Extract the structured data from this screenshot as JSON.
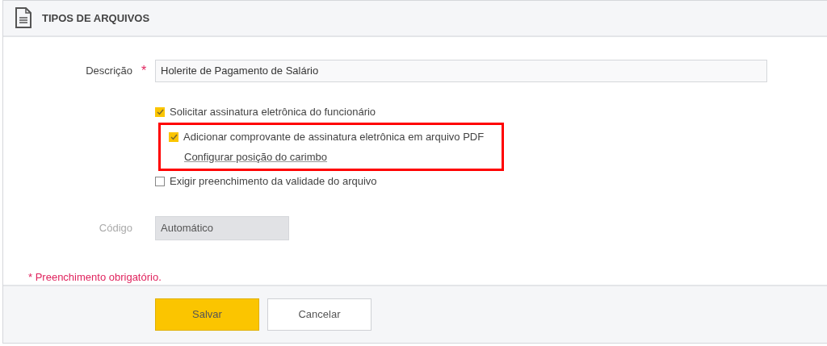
{
  "header": {
    "title": "TIPOS DE ARQUIVOS"
  },
  "description": {
    "label": "Descrição",
    "required_mark": "*",
    "value": "Holerite de Pagamento de Salário"
  },
  "options": [
    {
      "label": "Solicitar assinatura eletrônica do funcionário",
      "checked": true
    },
    {
      "label": "Adicionar comprovante de assinatura eletrônica em arquivo PDF",
      "checked": true,
      "highlighted": true,
      "link": "Configurar posição do carimbo"
    },
    {
      "label": "Exigir preenchimento da validade do arquivo",
      "checked": false
    }
  ],
  "code": {
    "label": "Código",
    "value": "Automático",
    "disabled": true
  },
  "required_note": "* Preenchimento obrigatório.",
  "buttons": [
    {
      "label": "Salvar",
      "kind": "primary"
    },
    {
      "label": "Cancelar",
      "kind": "secondary"
    }
  ]
}
